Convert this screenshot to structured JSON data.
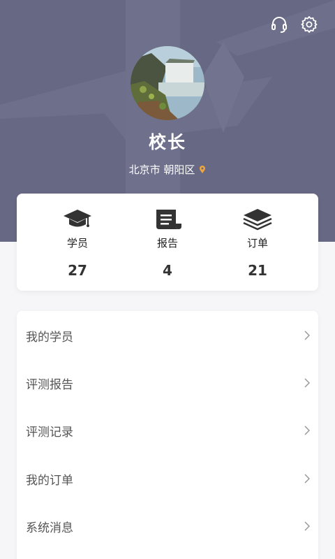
{
  "header": {
    "username": "校长",
    "location": "北京市 朝阳区",
    "icons": {
      "support": "headset-icon",
      "settings": "gear-icon",
      "location": "map-pin-icon"
    },
    "colors": {
      "header_bg": "#676884",
      "pin": "#f0a63c"
    }
  },
  "stats": [
    {
      "icon": "graduation-cap-icon",
      "label": "学员",
      "value": "27"
    },
    {
      "icon": "scroll-report-icon",
      "label": "报告",
      "value": "4"
    },
    {
      "icon": "layers-icon",
      "label": "订单",
      "value": "21"
    }
  ],
  "menu": [
    {
      "label": "我的学员"
    },
    {
      "label": "评测报告"
    },
    {
      "label": "评测记录"
    },
    {
      "label": "我的订单"
    },
    {
      "label": "系统消息"
    }
  ]
}
